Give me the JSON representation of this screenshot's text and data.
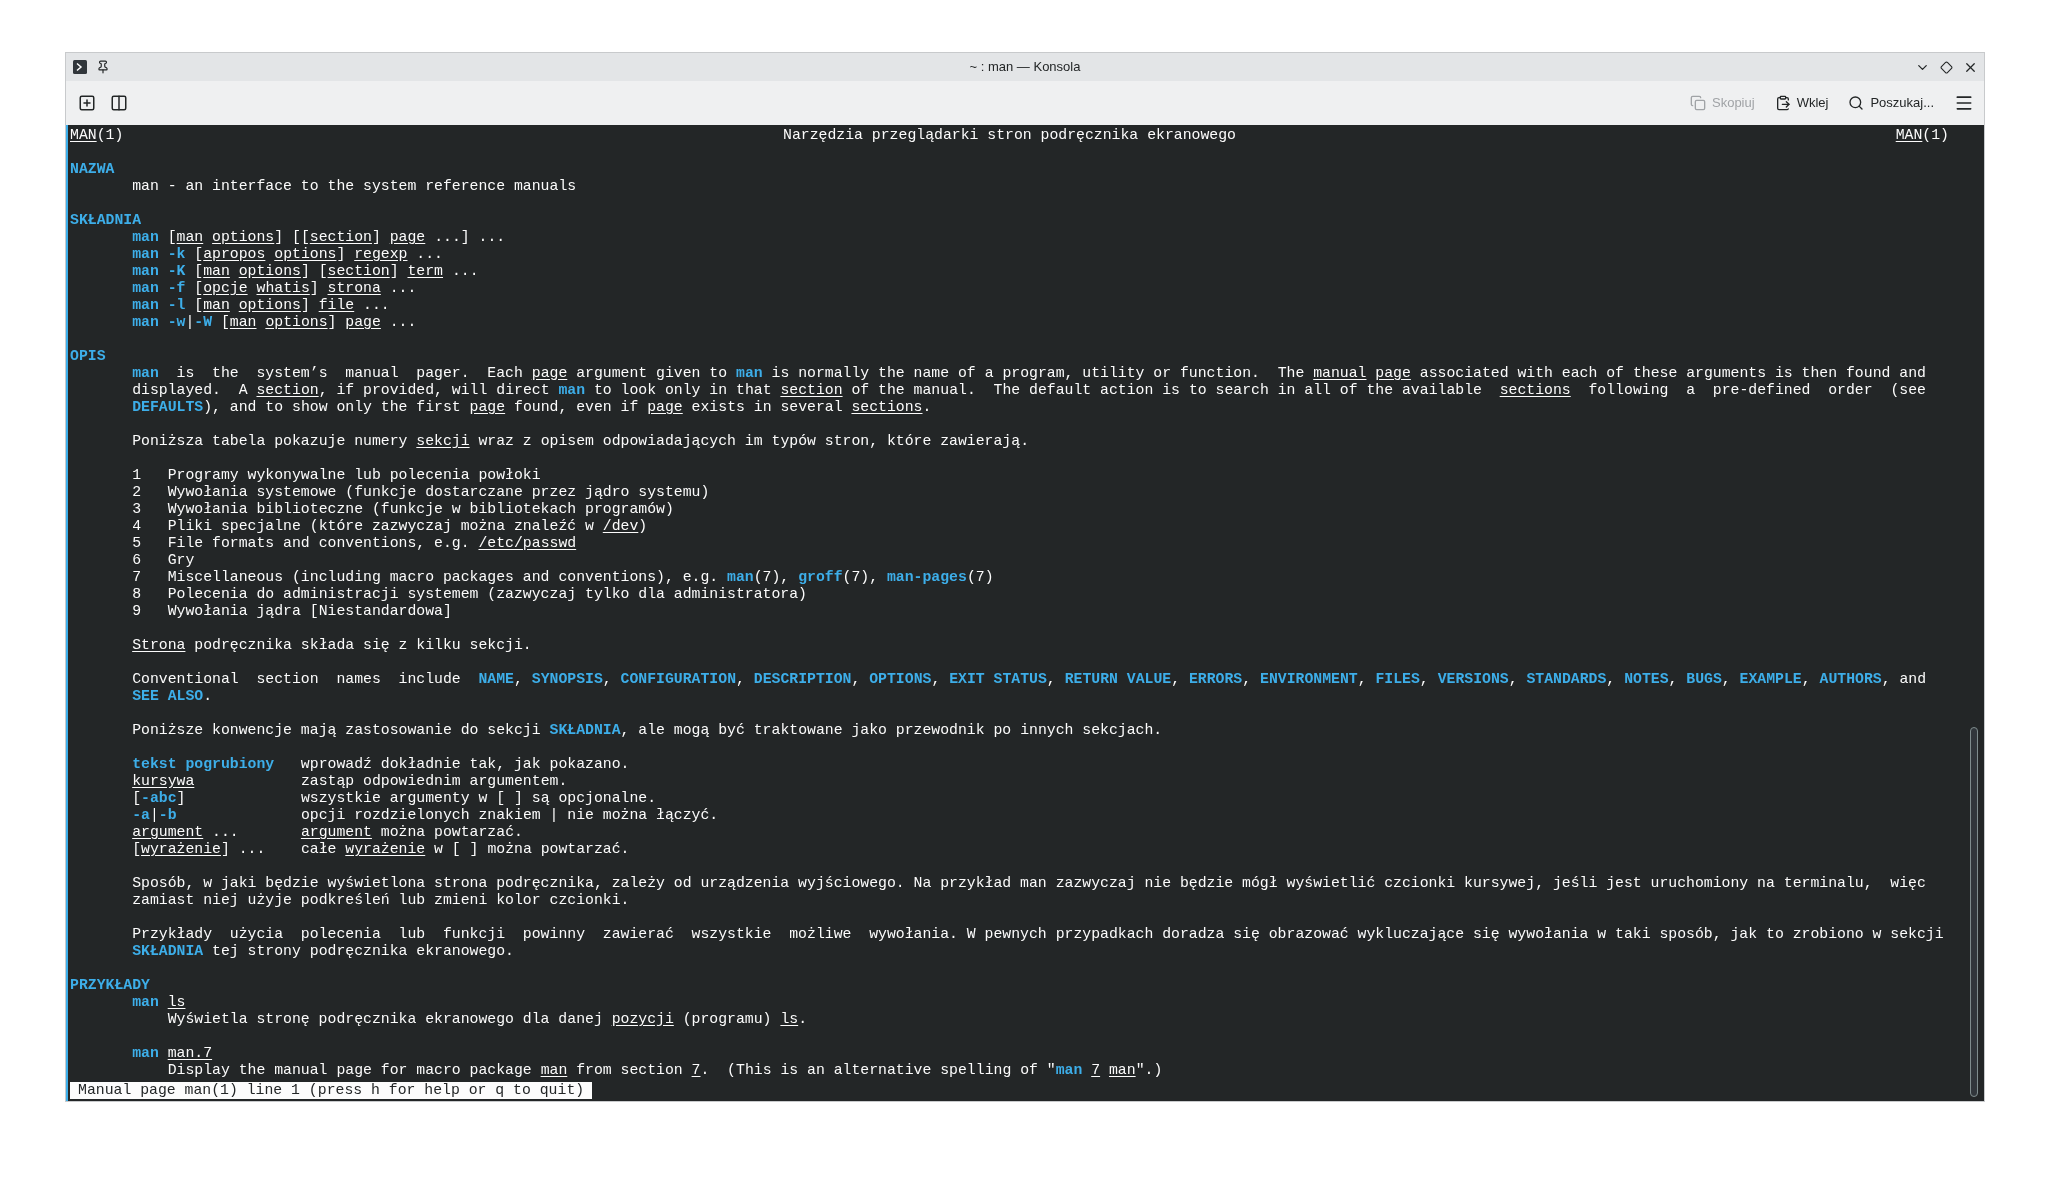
{
  "window": {
    "title": "~ : man — Konsola"
  },
  "toolbar": {
    "actions": [
      {
        "kind": "copy",
        "label": "Skopiuj",
        "disabled": true
      },
      {
        "kind": "paste",
        "label": "Wklej",
        "disabled": false
      },
      {
        "kind": "search",
        "label": "Poszukaj...",
        "disabled": false
      }
    ]
  },
  "terminal": {
    "header": {
      "left": "*MAN*(1)",
      "center": "Narzędzia przeglądarki stron podręcznika ekranowego",
      "right": "*MAN*(1)"
    },
    "sections": [
      {
        "heading": "NAZWA",
        "paragraphs": [
          {
            "kind": "body",
            "lines": [
              "man - an interface to the system reference manuals"
            ]
          }
        ]
      },
      {
        "heading": "SKŁADNIA",
        "paragraphs": [
          {
            "kind": "body",
            "lines": [
              "**man** [*man* *options*] [[*section*] *page* ...] ...",
              "**man -k** [*apropos* *options*] *regexp* ...",
              "**man -K** [*man* *options*] [*section*] *term* ...",
              "**man -f** [*opcje* *whatis*] *strona* ...",
              "**man -l** [*man* *options*] *file* ...",
              "**man -w**|**-W** [*man* *options*] *page* ..."
            ]
          }
        ]
      },
      {
        "heading": "OPIS",
        "paragraphs": [
          {
            "kind": "body",
            "lines": [
              "**man**  is  the  system’s  manual  pager.  Each *page* argument given to **man** is normally the name of a program, utility or function.  The *manual* *page* associated with each of these arguments is then found and",
              "displayed.  A *section*, if provided, will direct **man** to look only in that *section* of the manual.  The default action is to search in all of the available  *sections*  following  a  pre-defined  order  (see",
              "**DEFAULTS**), and to show only the first *page* found, even if *page* exists in several *sections*."
            ]
          },
          {
            "kind": "body",
            "lines": [
              "Poniższa tabela pokazuje numery *sekcji* wraz z opisem odpowiadających im typów stron, które zawierają."
            ]
          },
          {
            "kind": "body",
            "lines": [
              "1   Programy wykonywalne lub polecenia powłoki",
              "2   Wywołania systemowe (funkcje dostarczane przez jądro systemu)",
              "3   Wywołania biblioteczne (funkcje w bibliotekach programów)",
              "4   Pliki specjalne (które zazwyczaj można znaleźć w */dev*)",
              "5   File formats and conventions, e.g. */etc/passwd*",
              "6   Gry",
              "7   Miscellaneous (including macro packages and conventions), e.g. **man**(7), **groff**(7), **man-pages**(7)",
              "8   Polecenia do administracji systemem (zazwyczaj tylko dla administratora)",
              "9   Wywołania jądra [Niestandardowa]"
            ]
          },
          {
            "kind": "body",
            "lines": [
              "*Strona* podręcznika składa się z kilku sekcji."
            ]
          },
          {
            "kind": "body",
            "lines": [
              "Conventional  section  names  include  **NAME**, **SYNOPSIS**, **CONFIGURATION**, **DESCRIPTION**, **OPTIONS**, **EXIT STATUS**, **RETURN VALUE**, **ERRORS**, **ENVIRONMENT**, **FILES**, **VERSIONS**, **STANDARDS**, **NOTES**, **BUGS**, **EXAMPLE**, **AUTHORS**, and",
              "**SEE ALSO**."
            ]
          },
          {
            "kind": "body",
            "lines": [
              "Poniższe konwencje mają zastosowanie do sekcji **SKŁADNIA**, ale mogą być traktowane jako przewodnik po innych sekcjach."
            ]
          },
          {
            "kind": "body",
            "lines": [
              "**tekst pogrubiony**   wprowadź dokładnie tak, jak pokazano.",
              "*kursywa*            zastąp odpowiednim argumentem.",
              "[**-abc**]             wszystkie argumenty w [ ] są opcjonalne.",
              "**-a**|**-b**              opcji rozdzielonych znakiem | nie można łączyć.",
              "*argument* ...       *argument* można powtarzać.",
              "[*wyrażenie*] ...    całe *wyrażenie* w [ ] można powtarzać."
            ]
          },
          {
            "kind": "body",
            "lines": [
              "Sposób, w jaki będzie wyświetlona strona podręcznika, zależy od urządzenia wyjściowego. Na przykład man zazwyczaj nie będzie mógł wyświetlić czcionki kursywej, jeśli jest uruchomiony na terminalu,  więc",
              "zamiast niej użyje podkreśleń lub zmieni kolor czcionki."
            ]
          },
          {
            "kind": "body",
            "lines": [
              "Przykłady  użycia  polecenia  lub  funkcji  powinny  zawierać  wszystkie  możliwe  wywołania. W pewnych przypadkach doradza się obrazować wykluczające się wywołania w taki sposób, jak to zrobiono w sekcji",
              "**SKŁADNIA** tej strony podręcznika ekranowego."
            ]
          }
        ]
      },
      {
        "heading": "PRZYKŁADY",
        "paragraphs": [
          {
            "kind": "example",
            "lines": [
              "**man** *ls*",
              "Wyświetla stronę podręcznika ekranowego dla danej *pozycji* (programu) *ls*."
            ]
          },
          {
            "kind": "example",
            "lines": [
              "**man** *man.7*",
              "Display the manual page for macro package *man* from section *7*.  (This is an alternative spelling of \"**man** *7* *man*\".)"
            ]
          }
        ]
      }
    ],
    "status_line": "Manual page man(1) line 1 (press h for help or q to quit)"
  }
}
